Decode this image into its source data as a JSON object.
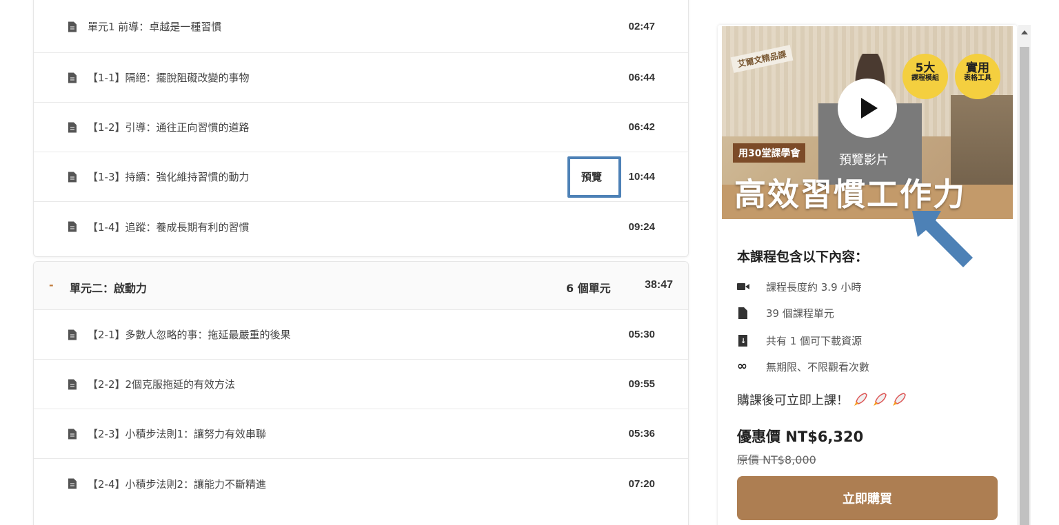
{
  "unit1_rows": [
    {
      "title": "單元1 前導：卓越是一種習慣",
      "duration": "02:47"
    },
    {
      "title": "【1-1】隔絕：擺脫阻礙改變的事物",
      "duration": "06:44"
    },
    {
      "title": "【1-2】引導：通往正向習慣的道路",
      "duration": "06:42"
    },
    {
      "title": "【1-3】持續：強化維持習慣的動力",
      "duration": "10:44",
      "preview": "預覽"
    },
    {
      "title": "【1-4】追蹤：養成長期有利的習慣",
      "duration": "09:24"
    }
  ],
  "section2": {
    "toggle": "-",
    "title": "單元二：啟動力",
    "count": "6 個單元",
    "duration": "38:47",
    "rows": [
      {
        "title": "【2-1】多數人忽略的事：拖延最嚴重的後果",
        "duration": "05:30"
      },
      {
        "title": "【2-2】2個克服拖延的有效方法",
        "duration": "09:55"
      },
      {
        "title": "【2-3】小積步法則1：讓努力有效串聯",
        "duration": "05:36"
      },
      {
        "title": "【2-4】小積步法則2：讓能力不斷精進",
        "duration": "07:20"
      }
    ]
  },
  "sidebar": {
    "video": {
      "tag_top": "艾爾文精品課",
      "badge1_big": "5大",
      "badge1_small": "課程模組",
      "badge2_big": "實用",
      "badge2_small": "表格工具",
      "tag_30": "用30堂課學會",
      "preview_label": "預覽影片",
      "big_title": "高效習慣工作力",
      "icon": "play-icon"
    },
    "includes_title": "本課程包含以下內容：",
    "includes": [
      {
        "icon": "video-icon",
        "text": "課程長度約 3.9 小時"
      },
      {
        "icon": "file-icon",
        "text": "39 個課程單元"
      },
      {
        "icon": "download-file-icon",
        "text": "共有 1 個可下載資源"
      },
      {
        "icon": "infinity-icon",
        "text": "無期限、不限觀看次數"
      }
    ],
    "after_buy": "購課後可立即上課！",
    "rocket_icon": "rocket-icon",
    "sale_price": "優惠價 NT$6,320",
    "original_price": "原價 NT$8,000",
    "buy_button": "立即購買"
  },
  "colors": {
    "annotation_blue": "#4d81b6",
    "buy_button": "#ad7e52"
  }
}
